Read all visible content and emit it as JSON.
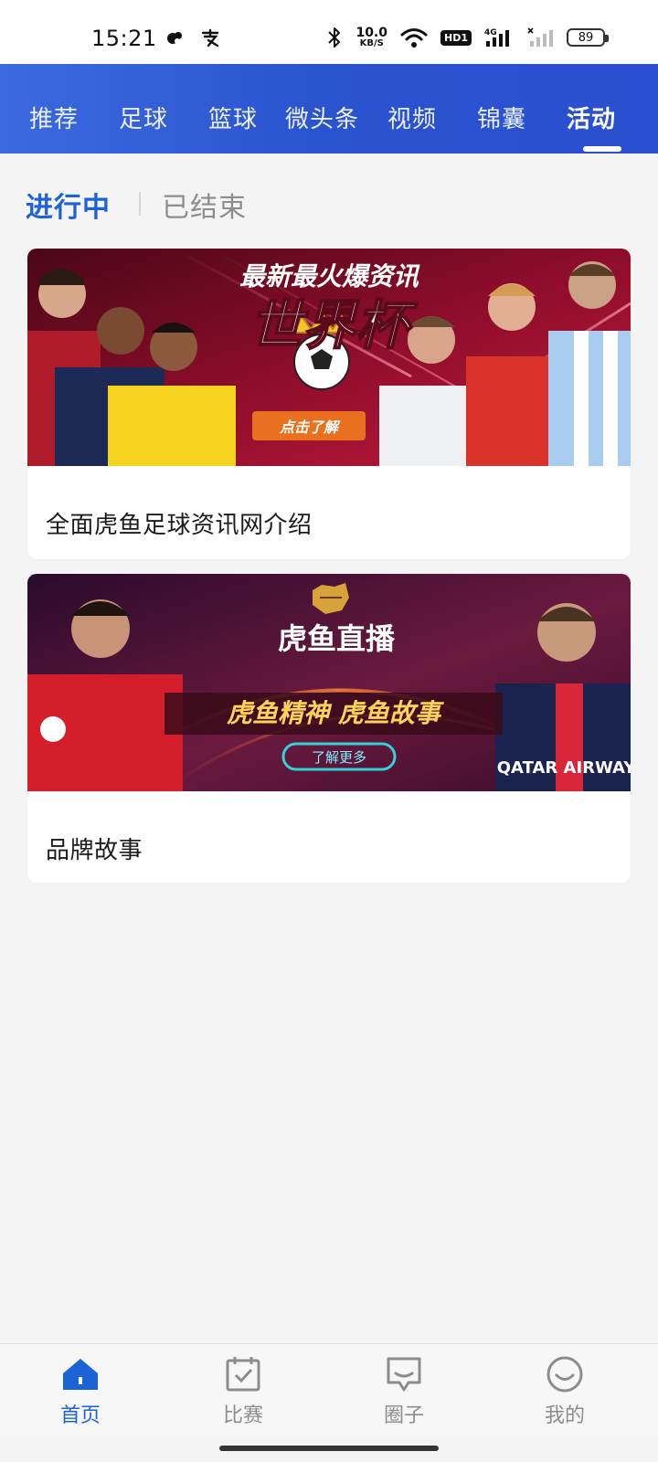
{
  "status_bar": {
    "time": "15:21",
    "net_speed_value": "10.0",
    "net_speed_unit": "KB/S",
    "hd_label": "HD1",
    "network_type": "4G",
    "battery": "89"
  },
  "top_tabs": [
    {
      "label": "推荐",
      "active": false
    },
    {
      "label": "足球",
      "active": false
    },
    {
      "label": "篮球",
      "active": false
    },
    {
      "label": "微头条",
      "active": false
    },
    {
      "label": "视频",
      "active": false
    },
    {
      "label": "锦囊",
      "active": false
    },
    {
      "label": "活动",
      "active": true
    }
  ],
  "filter": {
    "active_label": "进行中",
    "inactive_label": "已结束"
  },
  "cards": [
    {
      "title": "全面虎鱼足球资讯网介绍",
      "banner": {
        "headline": "最新最火爆资讯",
        "big_title": "世界杯",
        "cta": "点击了解",
        "colors": {
          "bg_from": "#5a0b1a",
          "bg_to": "#9d1030"
        }
      }
    },
    {
      "title": "品牌故事",
      "banner": {
        "headline": "虎鱼直播",
        "slogan": "虎鱼精神 虎鱼故事",
        "cta": "了解更多",
        "shirt_text": "QATAR AIRWAYS",
        "colors": {
          "bg_from": "#2d0b2e",
          "bg_to": "#7a1a3a"
        }
      }
    }
  ],
  "bottom_nav": [
    {
      "label": "首页",
      "icon": "home-icon",
      "active": true
    },
    {
      "label": "比赛",
      "icon": "calendar-check-icon",
      "active": false
    },
    {
      "label": "圈子",
      "icon": "chat-bubble-icon",
      "active": false
    },
    {
      "label": "我的",
      "icon": "smile-face-icon",
      "active": false
    }
  ],
  "colors": {
    "accent": "#1e63d6",
    "header_gradient_start": "#3b6ae0",
    "header_gradient_end": "#2a4fd0"
  }
}
